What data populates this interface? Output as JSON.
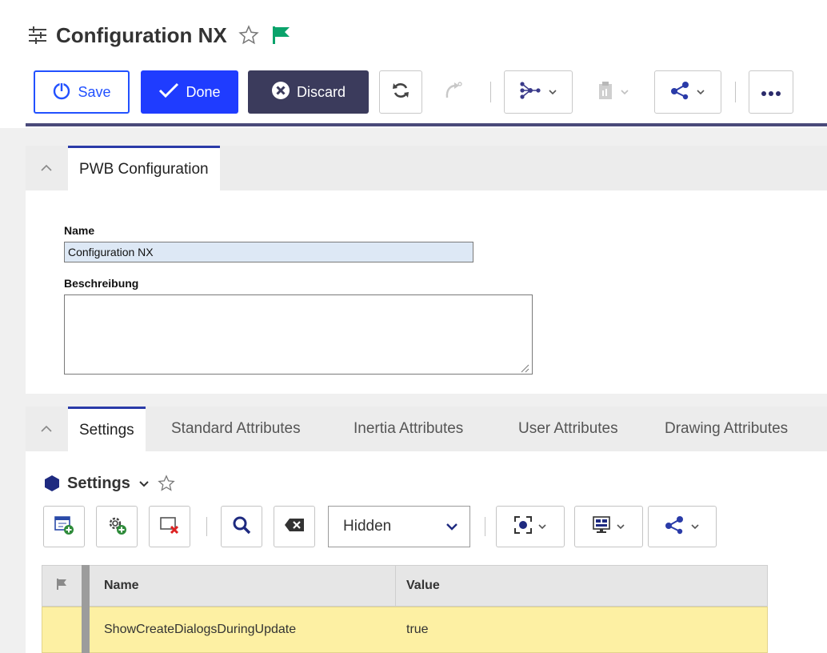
{
  "header": {
    "title": "Configuration NX"
  },
  "toolbar": {
    "save_label": "Save",
    "done_label": "Done",
    "discard_label": "Discard"
  },
  "panel1": {
    "tab_label": "PWB Configuration",
    "name_label": "Name",
    "name_value": "Configuration NX",
    "description_label": "Beschreibung",
    "description_value": ""
  },
  "panel2": {
    "tabs": [
      {
        "label": "Settings"
      },
      {
        "label": "Standard Attributes"
      },
      {
        "label": "Inertia Attributes"
      },
      {
        "label": "User Attributes"
      },
      {
        "label": "Drawing Attributes"
      }
    ],
    "section_title": "Settings",
    "filter_selected": "Hidden",
    "grid": {
      "columns": [
        "Name",
        "Value"
      ],
      "rows": [
        {
          "name": "ShowCreateDialogsDuringUpdate",
          "value": "true"
        }
      ]
    }
  },
  "colors": {
    "primary_blue": "#1f3cff",
    "discard_dark": "#3b3b5c",
    "flag_green": "#0aa36b",
    "selected_row": "#fdf0a3"
  }
}
